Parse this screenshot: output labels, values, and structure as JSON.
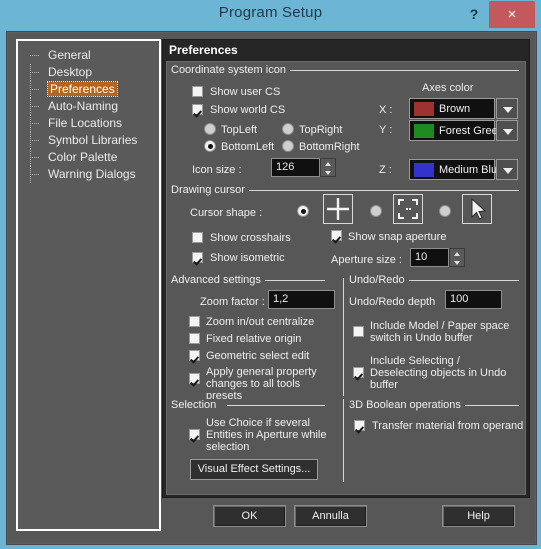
{
  "window": {
    "title": "Program Setup",
    "help_icon": "?",
    "close_icon": "×",
    "titlebar_color": "#6cb5d4",
    "close_color": "#c3595c"
  },
  "sidebar": {
    "items": [
      {
        "label": "General",
        "selected": false
      },
      {
        "label": "Desktop",
        "selected": false
      },
      {
        "label": "Preferences",
        "selected": true
      },
      {
        "label": "Auto-Naming",
        "selected": false
      },
      {
        "label": "File Locations",
        "selected": false
      },
      {
        "label": "Symbol Libraries",
        "selected": false
      },
      {
        "label": "Color Palette",
        "selected": false
      },
      {
        "label": "Warning Dialogs",
        "selected": false
      }
    ],
    "selected_color": "#b5651d"
  },
  "content": {
    "header": "Preferences",
    "coordinate_system": {
      "group_title": "Coordinate system icon",
      "show_user_cs": {
        "label": "Show user CS",
        "checked": false
      },
      "show_world_cs": {
        "label": "Show world CS",
        "checked": true
      },
      "position_options": [
        {
          "label": "TopLeft",
          "selected": false
        },
        {
          "label": "TopRight",
          "selected": false
        },
        {
          "label": "BottomLeft",
          "selected": true
        },
        {
          "label": "BottomRight",
          "selected": false
        }
      ],
      "icon_size": {
        "label": "Icon size :",
        "value": "126"
      },
      "axes_color": {
        "title": "Axes color",
        "rows": [
          {
            "axis": "X :",
            "value": "Brown",
            "swatch": "#9e3232"
          },
          {
            "axis": "Y :",
            "value": "Forest Green",
            "swatch": "#1f8a1f"
          },
          {
            "axis": "Z :",
            "value": "Medium Blue",
            "swatch": "#3333cc"
          }
        ]
      }
    },
    "drawing_cursor": {
      "group_title": "Drawing cursor",
      "cursor_shape_label": "Cursor shape :",
      "shapes": [
        {
          "icon": "crosshair-icon",
          "selected": true
        },
        {
          "icon": "snap-aperture-icon",
          "selected": false
        },
        {
          "icon": "arrow-pointer-icon",
          "selected": false
        }
      ],
      "show_crosshairs": {
        "label": "Show crosshairs",
        "checked": false
      },
      "show_isometric": {
        "label": "Show isometric",
        "checked": true
      },
      "show_snap_aperture": {
        "label": "Show snap aperture",
        "checked": true
      },
      "aperture_size": {
        "label": "Aperture size :",
        "value": "10"
      }
    },
    "advanced": {
      "group_title": "Advanced settings",
      "zoom_factor": {
        "label": "Zoom factor :",
        "value": "1,2"
      },
      "checks": [
        {
          "label": "Zoom in/out centralize",
          "checked": false
        },
        {
          "label": "Fixed relative origin",
          "checked": false
        },
        {
          "label": "Geometric select edit",
          "checked": true
        },
        {
          "label": "Apply general property changes to all tools presets",
          "checked": true
        }
      ]
    },
    "undo_redo": {
      "group_title": "Undo/Redo",
      "depth": {
        "label": "Undo/Redo depth",
        "value": "100"
      },
      "checks": [
        {
          "label": "Include Model / Paper space switch in Undo buffer",
          "checked": false
        },
        {
          "label": "Include Selecting / Deselecting objects in Undo buffer",
          "checked": true
        }
      ]
    },
    "selection": {
      "group_title": "Selection",
      "use_choice": {
        "label": "Use Choice if several Entities in Aperture while selection",
        "checked": true
      },
      "visual_effect_button": "Visual Effect Settings..."
    },
    "boolean": {
      "group_title": "3D Boolean operations",
      "transfer_material": {
        "label": "Transfer material from operand",
        "checked": true
      }
    }
  },
  "footer": {
    "ok": "OK",
    "cancel": "Annulla",
    "help": "Help"
  }
}
